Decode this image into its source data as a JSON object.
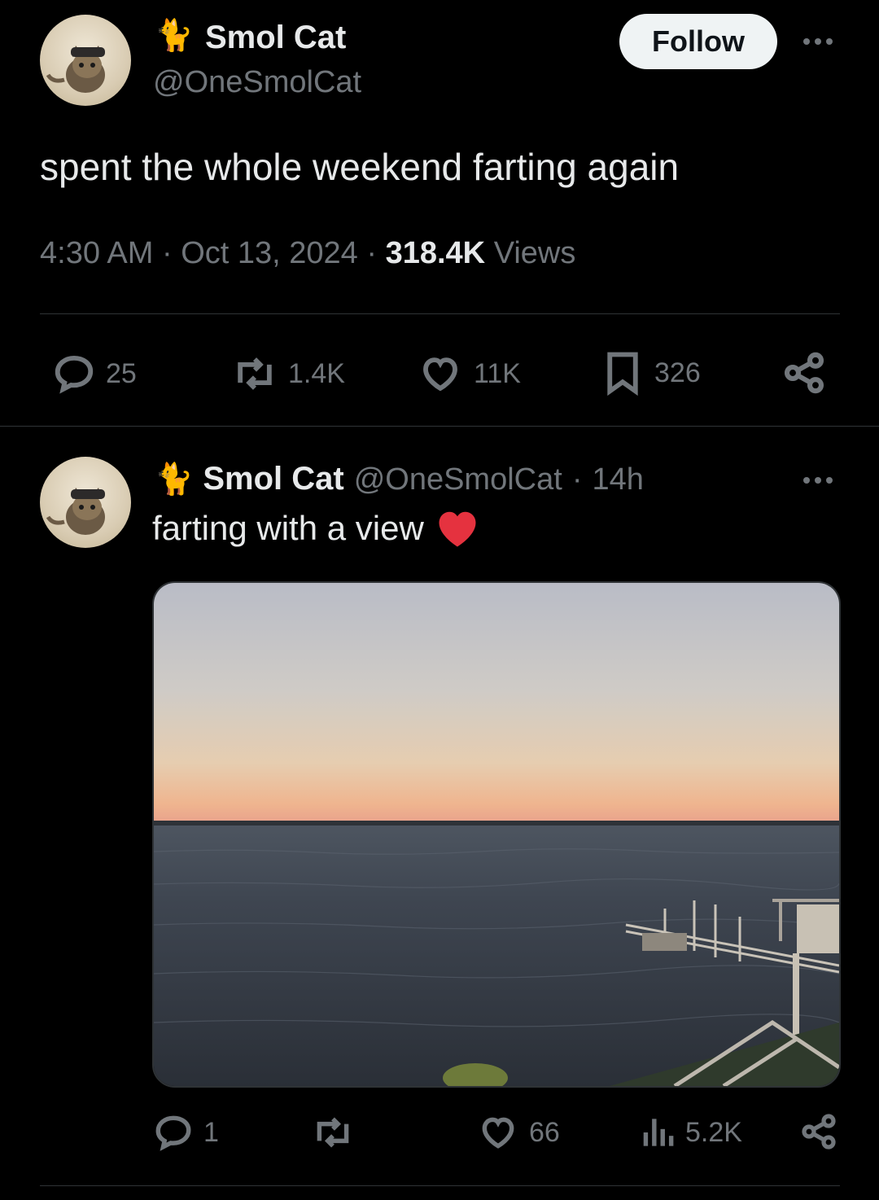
{
  "main_tweet": {
    "display_name": "Smol Cat",
    "handle": "@OneSmolCat",
    "follow_label": "Follow",
    "text": "spent the whole weekend farting again",
    "time": "4:30 AM",
    "date": "Oct 13, 2024",
    "views_count": "318.4K",
    "views_label": "Views",
    "sep": "·",
    "actions": {
      "replies": "25",
      "reposts": "1.4K",
      "likes": "11K",
      "bookmarks": "326"
    }
  },
  "reply_tweet": {
    "display_name": "Smol Cat",
    "handle": "@OneSmolCat",
    "sep": "·",
    "age": "14h",
    "text": "farting with a view",
    "actions": {
      "replies": "1",
      "likes": "66",
      "views": "5.2K"
    }
  },
  "icons": {
    "name_emoji": "cat-emoji",
    "heart_emoji": "red-heart"
  },
  "colors": {
    "background": "#000000",
    "text": "#e7e9ea",
    "muted": "#71767b",
    "divider": "#2f3336",
    "heart": "#f4212e"
  }
}
